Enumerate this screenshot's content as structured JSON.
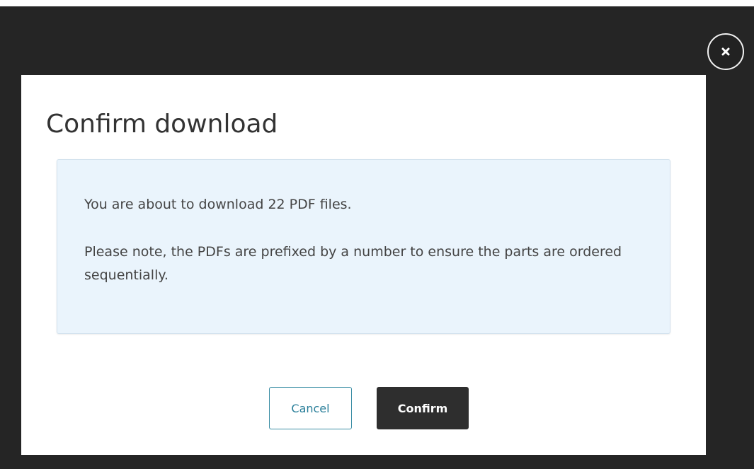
{
  "close": {
    "icon": "close-icon"
  },
  "dialog": {
    "title": "Confirm download",
    "message_1": "You are about to download 22 PDF files.",
    "message_2": "Please note, the PDFs are prefixed by a number to ensure the parts are ordered sequentially."
  },
  "actions": {
    "cancel_label": "Cancel",
    "confirm_label": "Confirm"
  },
  "colors": {
    "backdrop": "#252525",
    "info_background": "#eaf4fc",
    "cancel_text": "#2a7f9a",
    "confirm_background": "#2e2e2e"
  }
}
